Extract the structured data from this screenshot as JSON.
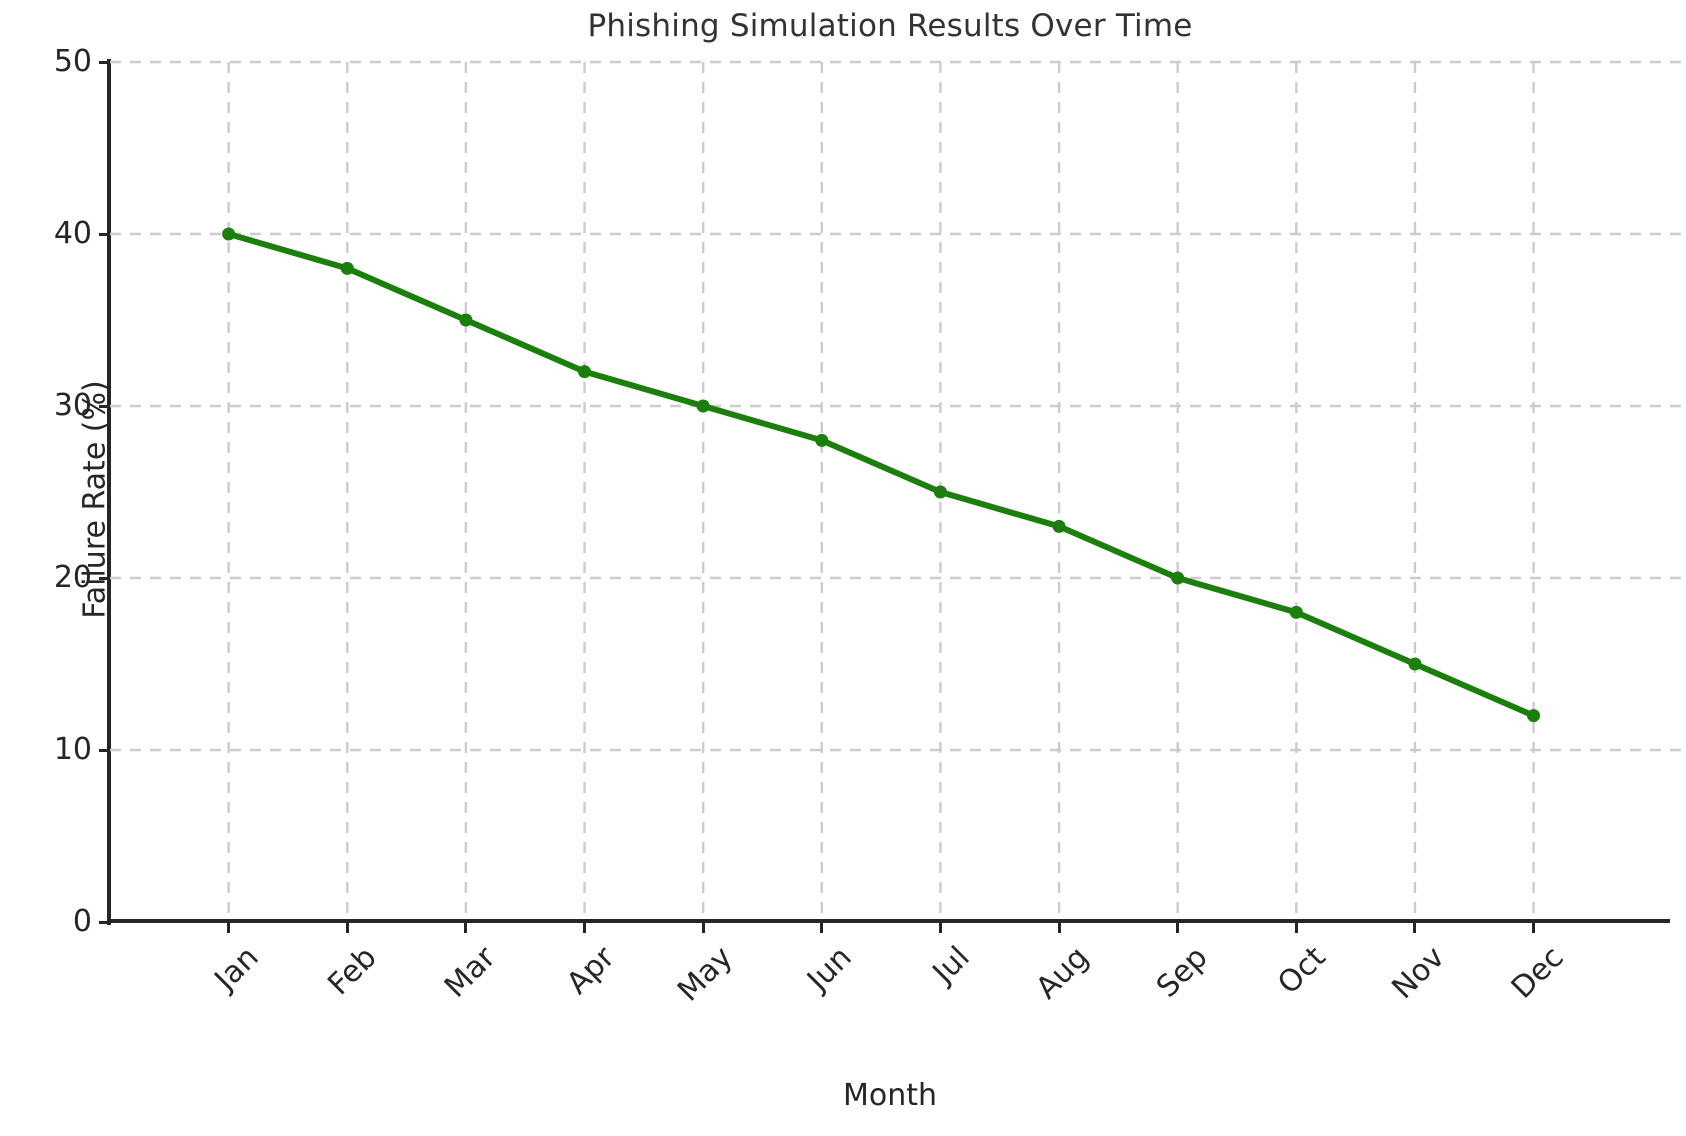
{
  "chart_data": {
    "type": "line",
    "title": "Phishing Simulation Results Over Time",
    "xlabel": "Month",
    "ylabel": "Failure Rate (%)",
    "categories": [
      "Jan",
      "Feb",
      "Mar",
      "Apr",
      "May",
      "Jun",
      "Jul",
      "Aug",
      "Sep",
      "Oct",
      "Nov",
      "Dec"
    ],
    "values": [
      40,
      38,
      35,
      32,
      30,
      28,
      25,
      23,
      20,
      18,
      15,
      12
    ],
    "series": [
      {
        "name": "Failure Rate (%)",
        "values": [
          40,
          38,
          35,
          32,
          30,
          28,
          25,
          23,
          20,
          18,
          15,
          12
        ]
      }
    ],
    "ylim": [
      0,
      50
    ],
    "yticks": [
      0,
      10,
      20,
      30,
      40,
      50
    ],
    "ytick_labels": [
      "0",
      "10",
      "20",
      "30",
      "40",
      "50"
    ],
    "xtick_labels": [
      "Jan",
      "Feb",
      "Mar",
      "Apr",
      "May",
      "Jun",
      "Jul",
      "Aug",
      "Sep",
      "Oct",
      "Nov",
      "Dec"
    ],
    "xtick_rotation": -45,
    "grid": true,
    "grid_style": "dashed",
    "grid_color": "#cccccc",
    "legend": null,
    "line_color": "#1b7f0b",
    "marker": "circle",
    "marker_color": "#1b7f0b",
    "line_width": 6,
    "marker_size": 13,
    "title_color": "#333333",
    "axis_color": "#262626",
    "background_color": "#ffffff"
  }
}
